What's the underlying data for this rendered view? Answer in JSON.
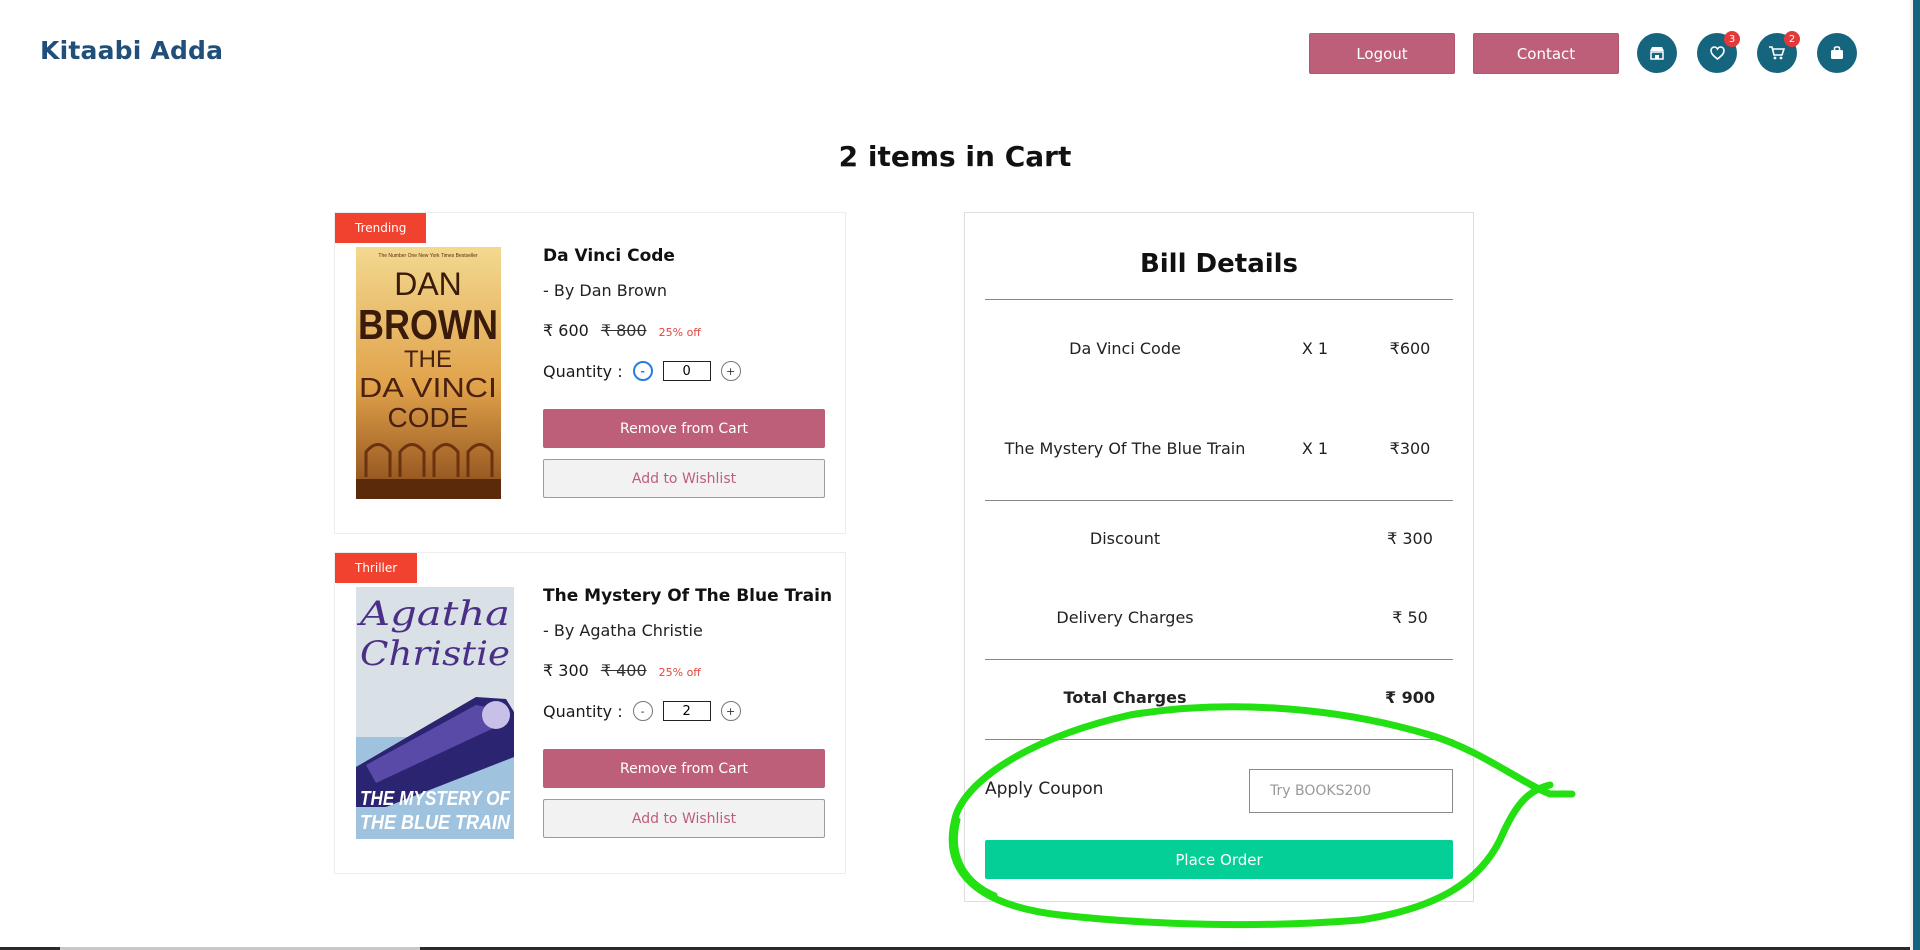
{
  "header": {
    "brand": "Kitaabi Adda",
    "logout_label": "Logout",
    "contact_label": "Contact",
    "icons": [
      {
        "name": "store-icon",
        "badge": ""
      },
      {
        "name": "heart-icon",
        "badge": "3"
      },
      {
        "name": "cart-icon",
        "badge": "2"
      },
      {
        "name": "bag-icon",
        "badge": ""
      }
    ],
    "brand_color": "#1f4f7a",
    "accent_color": "#bd5f79",
    "icon_bg_color": "#15657f"
  },
  "cart": {
    "heading": "2 items in Cart",
    "items": [
      {
        "tag": "Trending",
        "cover": {
          "line1": "DAN",
          "line2": "BROWN",
          "line3": "THE",
          "line4": "DA VINCI",
          "line5": "CODE",
          "top_note": "The Number One New York Times Bestseller"
        },
        "title": "Da Vinci Code",
        "author": "- By  Dan Brown",
        "price": "₹ 600",
        "old_price": "₹ 800",
        "discount": "25% off",
        "quantity_label": "Quantity :",
        "minus": "-",
        "plus": "+",
        "quantity": "0",
        "remove_label": "Remove from Cart",
        "wishlist_label": "Add to Wishlist"
      },
      {
        "tag": "Thriller",
        "cover": {
          "line1": "Agatha",
          "line2": "Christie",
          "line3": "THE MYSTERY OF",
          "line4": "THE BLUE TRAIN"
        },
        "title": "The Mystery Of The Blue Train",
        "author": "- By  Agatha Christie",
        "price": "₹ 300",
        "old_price": "₹ 400",
        "discount": "25% off",
        "quantity_label": "Quantity :",
        "minus": "-",
        "plus": "+",
        "quantity": "2",
        "remove_label": "Remove from Cart",
        "wishlist_label": "Add to Wishlist"
      }
    ]
  },
  "bill": {
    "title": "Bill Details",
    "lines": [
      {
        "name": "Da Vinci Code",
        "qty": "X 1",
        "amount": "₹600"
      },
      {
        "name": "The Mystery Of The Blue Train",
        "qty": "X 1",
        "amount": "₹300"
      }
    ],
    "discount_label": "Discount",
    "discount_value": "₹ 300",
    "delivery_label": "Delivery Charges",
    "delivery_value": "₹ 50",
    "total_label": "Total Charges",
    "total_value": "₹ 900",
    "coupon_label": "Apply Coupon",
    "coupon_placeholder": "Try BOOKS200",
    "coupon_value": "",
    "place_order_label": "Place Order",
    "place_order_color": "#04cf96"
  },
  "annotation_color": "#22e011"
}
